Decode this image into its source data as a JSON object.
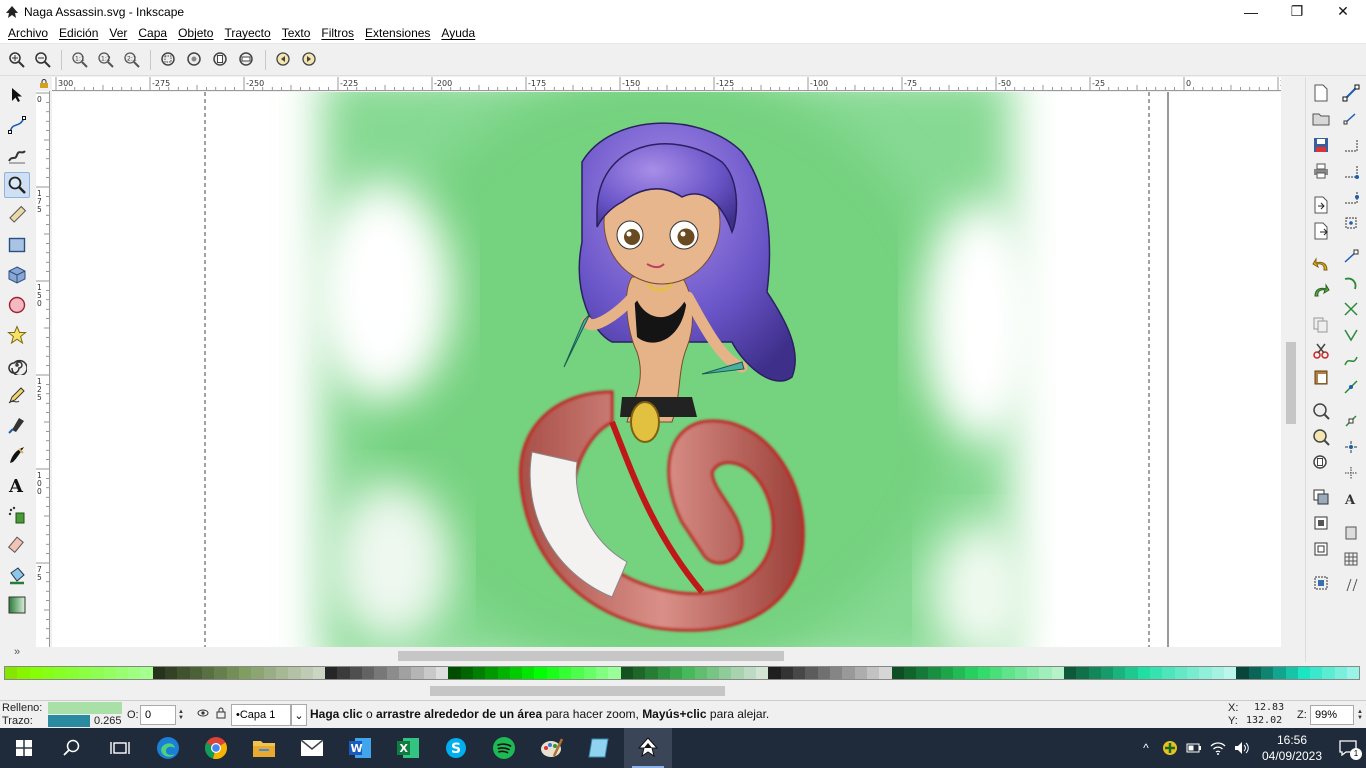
{
  "window": {
    "title": "Naga Assassin.svg - Inkscape",
    "minimize": "—",
    "maximize": "❐",
    "close": "✕"
  },
  "menu": {
    "items": [
      "Archivo",
      "Edición",
      "Ver",
      "Capa",
      "Objeto",
      "Trayecto",
      "Texto",
      "Filtros",
      "Extensiones",
      "Ayuda"
    ]
  },
  "ruler": {
    "top_labels": [
      "300",
      "-275",
      "-250",
      "-225",
      "-200",
      "-175",
      "-150",
      "-125",
      "-100",
      "-75",
      "-50",
      "-25",
      "0",
      "25"
    ],
    "left_labels": [
      "0",
      "1\n7\n5",
      "1\n5\n0",
      "1\n2\n5",
      "1\n0\n0",
      "7\n5"
    ]
  },
  "status": {
    "fill_label": "Relleno:",
    "stroke_label": "Trazo:",
    "fill_color": "#a8e0a8",
    "stroke_color": "#2a8aa0",
    "stroke_width": "0.265",
    "opacity_label": "O:",
    "opacity_value": "0",
    "layer_value": "•Capa 1",
    "msg_part1": "Haga clic",
    "msg_part2": " o ",
    "msg_part3": "arrastre alrededor de un área",
    "msg_part4": " para hacer zoom, ",
    "msg_part5": "Mayús+clic",
    "msg_part6": " para alejar.",
    "x_label": "X:",
    "x_value": "12.83",
    "y_label": "Y:",
    "y_value": "132.02",
    "z_label": "Z:",
    "z_value": "99%"
  },
  "taskbar": {
    "time": "16:56",
    "date": "04/09/2023",
    "notifications": "1"
  },
  "colors": {
    "accent": "#8fb3dd",
    "canvas_green": "#7dd68a",
    "taskbar": "#1f2a3a"
  },
  "icons": {
    "tools": [
      "selector-arrow-icon",
      "node-tool-icon",
      "tweak-tool-icon",
      "zoom-tool-icon",
      "measure-tool-icon",
      "rect-tool-icon",
      "3d-box-tool-icon",
      "ellipse-tool-icon",
      "star-tool-icon",
      "spiral-tool-icon",
      "pencil-tool-icon",
      "pen-tool-icon",
      "calligraphy-tool-icon",
      "text-tool-icon",
      "spray-tool-icon",
      "eraser-tool-icon",
      "paint-bucket-icon",
      "gradient-tool-icon"
    ]
  }
}
